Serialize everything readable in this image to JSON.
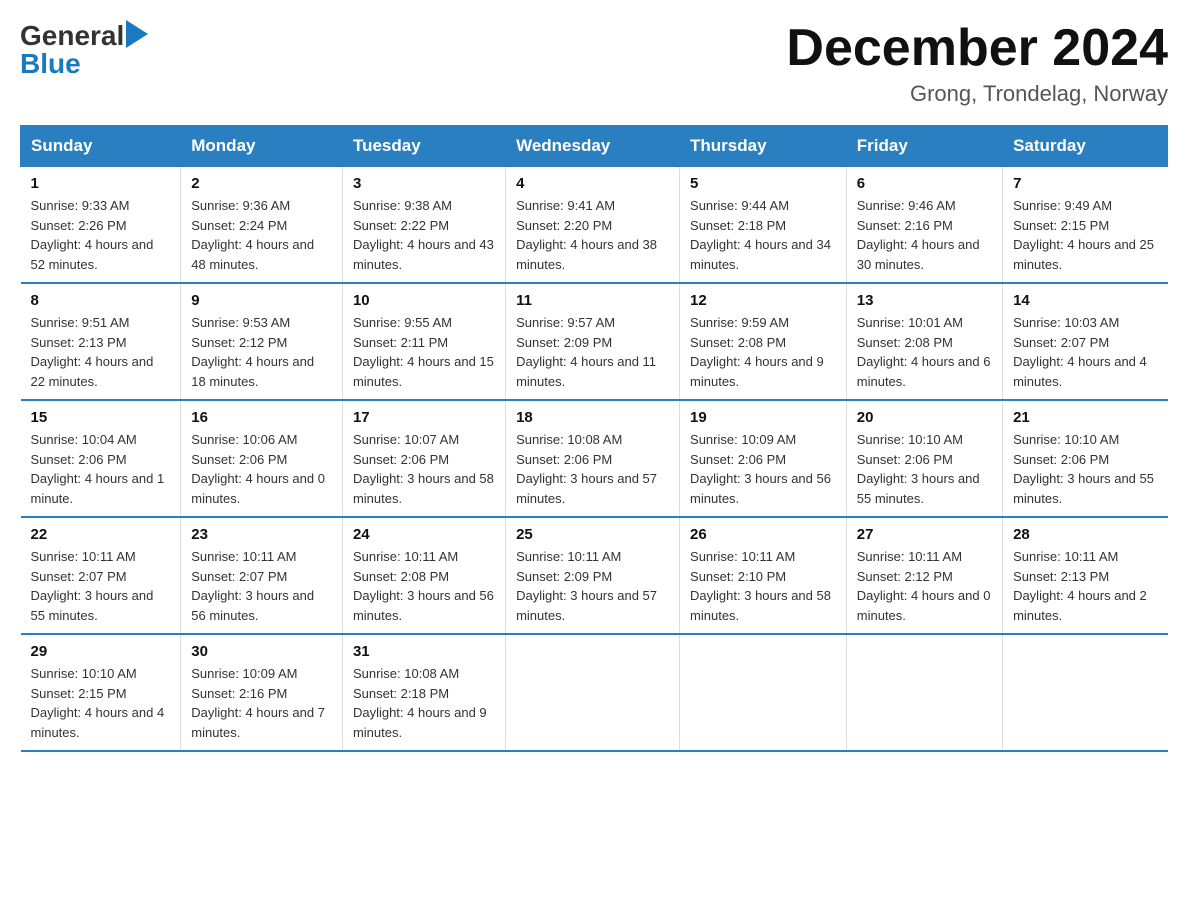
{
  "logo": {
    "general": "General",
    "blue": "Blue"
  },
  "title": "December 2024",
  "location": "Grong, Trondelag, Norway",
  "days_of_week": [
    "Sunday",
    "Monday",
    "Tuesday",
    "Wednesday",
    "Thursday",
    "Friday",
    "Saturday"
  ],
  "weeks": [
    [
      {
        "day": "1",
        "sunrise": "9:33 AM",
        "sunset": "2:26 PM",
        "daylight": "4 hours and 52 minutes."
      },
      {
        "day": "2",
        "sunrise": "9:36 AM",
        "sunset": "2:24 PM",
        "daylight": "4 hours and 48 minutes."
      },
      {
        "day": "3",
        "sunrise": "9:38 AM",
        "sunset": "2:22 PM",
        "daylight": "4 hours and 43 minutes."
      },
      {
        "day": "4",
        "sunrise": "9:41 AM",
        "sunset": "2:20 PM",
        "daylight": "4 hours and 38 minutes."
      },
      {
        "day": "5",
        "sunrise": "9:44 AM",
        "sunset": "2:18 PM",
        "daylight": "4 hours and 34 minutes."
      },
      {
        "day": "6",
        "sunrise": "9:46 AM",
        "sunset": "2:16 PM",
        "daylight": "4 hours and 30 minutes."
      },
      {
        "day": "7",
        "sunrise": "9:49 AM",
        "sunset": "2:15 PM",
        "daylight": "4 hours and 25 minutes."
      }
    ],
    [
      {
        "day": "8",
        "sunrise": "9:51 AM",
        "sunset": "2:13 PM",
        "daylight": "4 hours and 22 minutes."
      },
      {
        "day": "9",
        "sunrise": "9:53 AM",
        "sunset": "2:12 PM",
        "daylight": "4 hours and 18 minutes."
      },
      {
        "day": "10",
        "sunrise": "9:55 AM",
        "sunset": "2:11 PM",
        "daylight": "4 hours and 15 minutes."
      },
      {
        "day": "11",
        "sunrise": "9:57 AM",
        "sunset": "2:09 PM",
        "daylight": "4 hours and 11 minutes."
      },
      {
        "day": "12",
        "sunrise": "9:59 AM",
        "sunset": "2:08 PM",
        "daylight": "4 hours and 9 minutes."
      },
      {
        "day": "13",
        "sunrise": "10:01 AM",
        "sunset": "2:08 PM",
        "daylight": "4 hours and 6 minutes."
      },
      {
        "day": "14",
        "sunrise": "10:03 AM",
        "sunset": "2:07 PM",
        "daylight": "4 hours and 4 minutes."
      }
    ],
    [
      {
        "day": "15",
        "sunrise": "10:04 AM",
        "sunset": "2:06 PM",
        "daylight": "4 hours and 1 minute."
      },
      {
        "day": "16",
        "sunrise": "10:06 AM",
        "sunset": "2:06 PM",
        "daylight": "4 hours and 0 minutes."
      },
      {
        "day": "17",
        "sunrise": "10:07 AM",
        "sunset": "2:06 PM",
        "daylight": "3 hours and 58 minutes."
      },
      {
        "day": "18",
        "sunrise": "10:08 AM",
        "sunset": "2:06 PM",
        "daylight": "3 hours and 57 minutes."
      },
      {
        "day": "19",
        "sunrise": "10:09 AM",
        "sunset": "2:06 PM",
        "daylight": "3 hours and 56 minutes."
      },
      {
        "day": "20",
        "sunrise": "10:10 AM",
        "sunset": "2:06 PM",
        "daylight": "3 hours and 55 minutes."
      },
      {
        "day": "21",
        "sunrise": "10:10 AM",
        "sunset": "2:06 PM",
        "daylight": "3 hours and 55 minutes."
      }
    ],
    [
      {
        "day": "22",
        "sunrise": "10:11 AM",
        "sunset": "2:07 PM",
        "daylight": "3 hours and 55 minutes."
      },
      {
        "day": "23",
        "sunrise": "10:11 AM",
        "sunset": "2:07 PM",
        "daylight": "3 hours and 56 minutes."
      },
      {
        "day": "24",
        "sunrise": "10:11 AM",
        "sunset": "2:08 PM",
        "daylight": "3 hours and 56 minutes."
      },
      {
        "day": "25",
        "sunrise": "10:11 AM",
        "sunset": "2:09 PM",
        "daylight": "3 hours and 57 minutes."
      },
      {
        "day": "26",
        "sunrise": "10:11 AM",
        "sunset": "2:10 PM",
        "daylight": "3 hours and 58 minutes."
      },
      {
        "day": "27",
        "sunrise": "10:11 AM",
        "sunset": "2:12 PM",
        "daylight": "4 hours and 0 minutes."
      },
      {
        "day": "28",
        "sunrise": "10:11 AM",
        "sunset": "2:13 PM",
        "daylight": "4 hours and 2 minutes."
      }
    ],
    [
      {
        "day": "29",
        "sunrise": "10:10 AM",
        "sunset": "2:15 PM",
        "daylight": "4 hours and 4 minutes."
      },
      {
        "day": "30",
        "sunrise": "10:09 AM",
        "sunset": "2:16 PM",
        "daylight": "4 hours and 7 minutes."
      },
      {
        "day": "31",
        "sunrise": "10:08 AM",
        "sunset": "2:18 PM",
        "daylight": "4 hours and 9 minutes."
      },
      null,
      null,
      null,
      null
    ]
  ]
}
